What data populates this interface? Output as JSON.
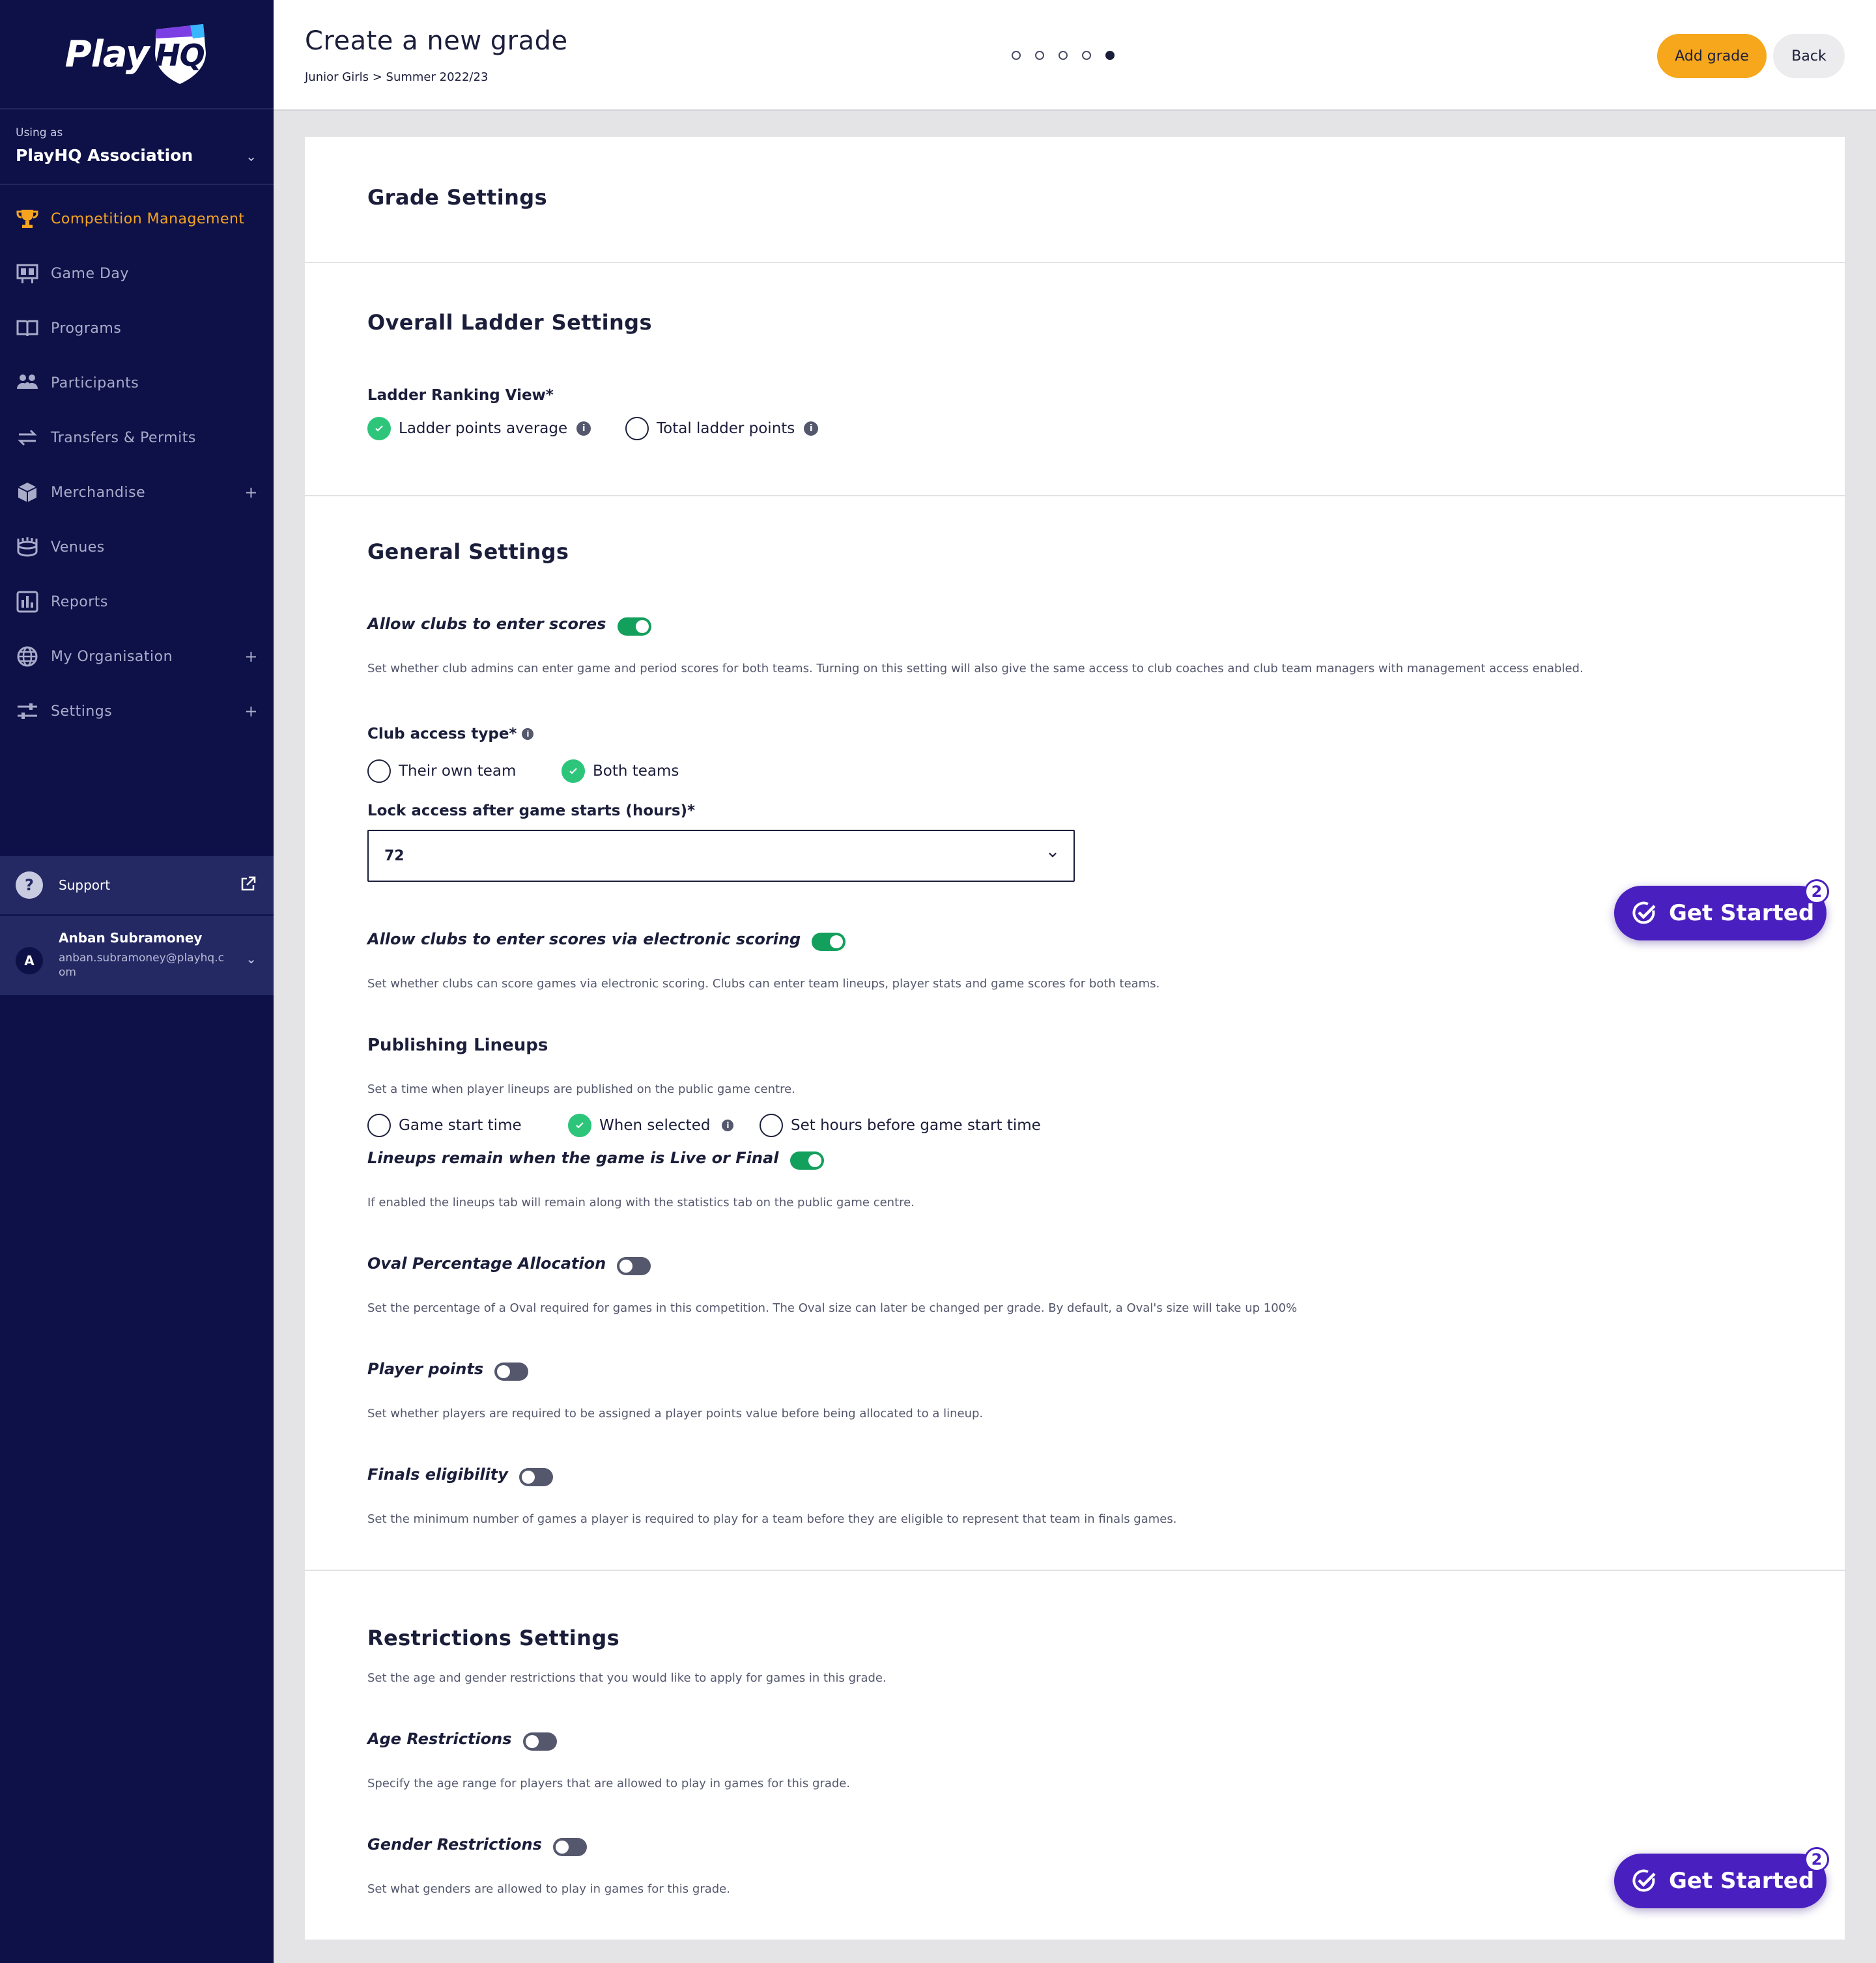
{
  "brand": {
    "logo_text_a": "Play",
    "logo_text_b": "HQ",
    "accent": "#f6a420",
    "sidebar_bg": "#0e1148"
  },
  "org": {
    "using_as": "Using as",
    "name": "PlayHQ Association"
  },
  "nav": {
    "items": [
      {
        "label": "Competition Management",
        "icon": "trophy-icon"
      },
      {
        "label": "Game Day",
        "icon": "scoreboard-icon"
      },
      {
        "label": "Programs",
        "icon": "book-icon"
      },
      {
        "label": "Participants",
        "icon": "people-icon"
      },
      {
        "label": "Transfers & Permits",
        "icon": "transfer-icon"
      },
      {
        "label": "Merchandise",
        "icon": "box-icon"
      },
      {
        "label": "Venues",
        "icon": "stadium-icon"
      },
      {
        "label": "Reports",
        "icon": "reports-icon"
      },
      {
        "label": "My Organisation",
        "icon": "globe-icon"
      },
      {
        "label": "Settings",
        "icon": "sliders-icon"
      }
    ],
    "plus": "+"
  },
  "support": {
    "label": "Support",
    "q": "?"
  },
  "user": {
    "initial": "A",
    "name": "Anban Subramoney",
    "email": "anban.subramoney@playhq.com"
  },
  "header": {
    "title": "Create a new grade",
    "breadcrumb": "Junior Girls > Summer 2022/23",
    "add_label": "Add grade",
    "back_label": "Back"
  },
  "grade_settings": {
    "title": "Grade Settings"
  },
  "ladder": {
    "title": "Overall Ladder Settings",
    "ranking_label": "Ladder Ranking View*",
    "opt_average": "Ladder points average",
    "opt_total": "Total ladder points"
  },
  "general": {
    "title": "General Settings",
    "allow_scores": "Allow clubs to enter scores",
    "allow_scores_desc": "Set whether club admins can enter game and period scores for both teams. Turning on this setting will also give the same access to club coaches and club team managers with management access enabled.",
    "club_access": "Club access type*",
    "opt_own": "Their own team",
    "opt_both": "Both teams",
    "lock_label": "Lock access after game starts (hours)*",
    "lock_value": "72",
    "electronic": "Allow clubs to enter scores via electronic scoring",
    "electronic_desc": "Set whether clubs can score games via electronic scoring. Clubs can enter team lineups, player stats and game scores for both teams.",
    "publishing": "Publishing Lineups",
    "publishing_desc": "Set a time when player lineups are published on the public game centre.",
    "opt_start": "Game start time",
    "opt_selected": "When selected",
    "opt_hours": "Set hours before game start time",
    "lineups_remain": "Lineups remain when the game is Live or Final",
    "lineups_desc": "If enabled the lineups tab will remain along with the statistics tab on the public game centre.",
    "oval": "Oval Percentage Allocation",
    "oval_desc": "Set the percentage of a Oval required for games in this competition. The Oval size can later be changed per grade. By default, a Oval's size will take up 100%",
    "player_points": "Player points",
    "player_points_desc": "Set whether players are required to be assigned a player points value before being allocated to a lineup.",
    "finals": "Finals eligibility",
    "finals_desc": "Set the minimum number of games a player is required to play for a team before they are eligible to represent that team in finals games."
  },
  "restrictions": {
    "title": "Restrictions Settings",
    "desc": "Set the age and gender restrictions that you would like to apply for games in this grade.",
    "age": "Age Restrictions",
    "age_desc": "Specify the age range for players that are allowed to play in games for this grade.",
    "gender": "Gender Restrictions",
    "gender_desc": "Set what genders are allowed to play in games for this grade."
  },
  "get_started": {
    "label": "Get Started",
    "badge": "2"
  },
  "info_glyph": "i"
}
